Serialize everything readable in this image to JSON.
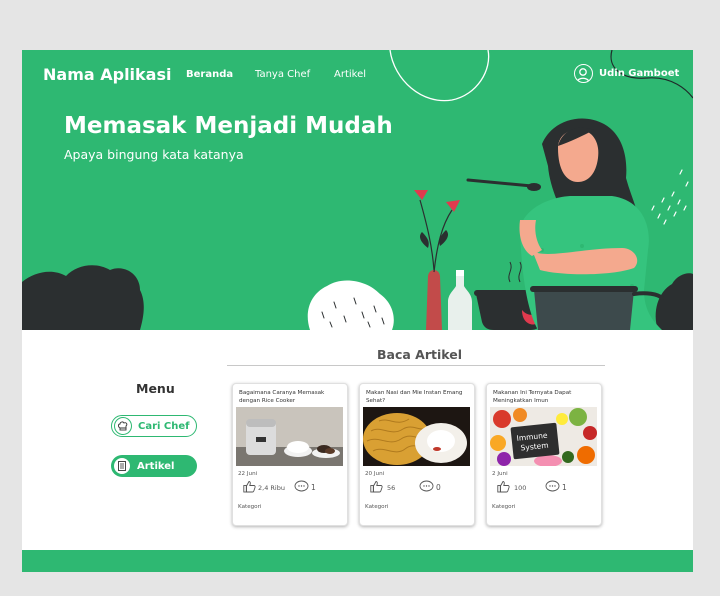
{
  "colors": {
    "brand_green": "#2eb872",
    "text_dark": "#333333",
    "background": "#e5e5e5"
  },
  "app": {
    "title": "Nama Aplikasi"
  },
  "nav": {
    "items": [
      {
        "label": "Beranda",
        "active": true
      },
      {
        "label": "Tanya Chef",
        "active": false
      },
      {
        "label": "Artikel",
        "active": false
      }
    ]
  },
  "user": {
    "name": "Udin Gamboet",
    "icon": "user-circle-icon"
  },
  "hero": {
    "title": "Memasak Menjadi Mudah",
    "subtitle": "Apaya bingung kata katanya"
  },
  "section": {
    "title": "Baca Artikel"
  },
  "menu": {
    "title": "Menu",
    "buttons": [
      {
        "label": "Cari Chef",
        "icon": "chef-hat-icon"
      },
      {
        "label": "Artikel",
        "icon": "article-icon"
      }
    ]
  },
  "articles": [
    {
      "title": "Bagaimana Caranya Memasak dengan Rice Cooker",
      "date": "22 Juni",
      "likes": "2,4 Ribu",
      "comments": "1",
      "category": "Kategori"
    },
    {
      "title": "Makan Nasi dan Mie Instan Emang Sehat?",
      "date": "20 Juni",
      "likes": "56",
      "comments": "0",
      "category": "Kategori"
    },
    {
      "title": "Makanan Ini Ternyata Dapat Meningkatkan Imun",
      "date": "2 Juni",
      "likes": "100",
      "comments": "1",
      "category": "Kategori",
      "image_text": "Immune System"
    }
  ]
}
